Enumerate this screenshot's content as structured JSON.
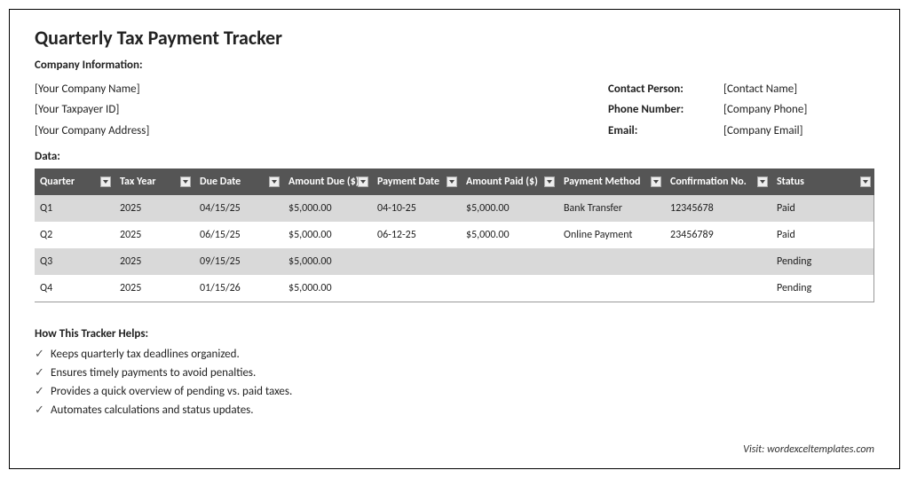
{
  "title": "Quarterly Tax Payment Tracker",
  "sections": {
    "company_info_label": "Company Information:",
    "data_label": "Data:",
    "helps_label": "How This Tracker Helps:"
  },
  "company_left": {
    "name": "[Your Company Name]",
    "taxpayer_id": "[Your Taxpayer ID]",
    "address": "[Your Company Address]"
  },
  "company_right": {
    "contact_label": "Contact Person:",
    "contact_value": "[Contact Name]",
    "phone_label": "Phone Number:",
    "phone_value": "[Company Phone]",
    "email_label": "Email:",
    "email_value": "[Company Email]"
  },
  "table": {
    "headers": {
      "quarter": "Quarter",
      "tax_year": "Tax Year",
      "due_date": "Due Date",
      "amount_due": "Amount Due ($)",
      "payment_date": "Payment Date",
      "amount_paid": "Amount Paid ($)",
      "payment_method": "Payment Method",
      "confirmation": "Confirmation No.",
      "status": "Status"
    },
    "rows": [
      {
        "quarter": "Q1",
        "tax_year": "2025",
        "due_date": "04/15/25",
        "amount_due": "$5,000.00",
        "payment_date": "04-10-25",
        "amount_paid": "$5,000.00",
        "payment_method": "Bank Transfer",
        "confirmation": "12345678",
        "status": "Paid"
      },
      {
        "quarter": "Q2",
        "tax_year": "2025",
        "due_date": "06/15/25",
        "amount_due": "$5,000.00",
        "payment_date": "06-12-25",
        "amount_paid": "$5,000.00",
        "payment_method": "Online Payment",
        "confirmation": "23456789",
        "status": "Paid"
      },
      {
        "quarter": "Q3",
        "tax_year": "2025",
        "due_date": "09/15/25",
        "amount_due": "$5,000.00",
        "payment_date": "",
        "amount_paid": "",
        "payment_method": "",
        "confirmation": "",
        "status": "Pending"
      },
      {
        "quarter": "Q4",
        "tax_year": "2025",
        "due_date": "01/15/26",
        "amount_due": "$5,000.00",
        "payment_date": "",
        "amount_paid": "",
        "payment_method": "",
        "confirmation": "",
        "status": "Pending"
      }
    ]
  },
  "helps": [
    "Keeps quarterly tax deadlines organized.",
    "Ensures timely payments to avoid penalties.",
    "Provides a quick overview of pending vs. paid taxes.",
    "Automates calculations and status updates."
  ],
  "footer": "Visit: wordexceltemplates.com",
  "chart_data": {
    "type": "table",
    "title": "Quarterly Tax Payment Tracker",
    "columns": [
      "Quarter",
      "Tax Year",
      "Due Date",
      "Amount Due ($)",
      "Payment Date",
      "Amount Paid ($)",
      "Payment Method",
      "Confirmation No.",
      "Status"
    ],
    "rows": [
      [
        "Q1",
        "2025",
        "04/15/25",
        5000.0,
        "04-10-25",
        5000.0,
        "Bank Transfer",
        "12345678",
        "Paid"
      ],
      [
        "Q2",
        "2025",
        "06/15/25",
        5000.0,
        "06-12-25",
        5000.0,
        "Online Payment",
        "23456789",
        "Paid"
      ],
      [
        "Q3",
        "2025",
        "09/15/25",
        5000.0,
        null,
        null,
        null,
        null,
        "Pending"
      ],
      [
        "Q4",
        "2025",
        "01/15/26",
        5000.0,
        null,
        null,
        null,
        null,
        "Pending"
      ]
    ]
  }
}
